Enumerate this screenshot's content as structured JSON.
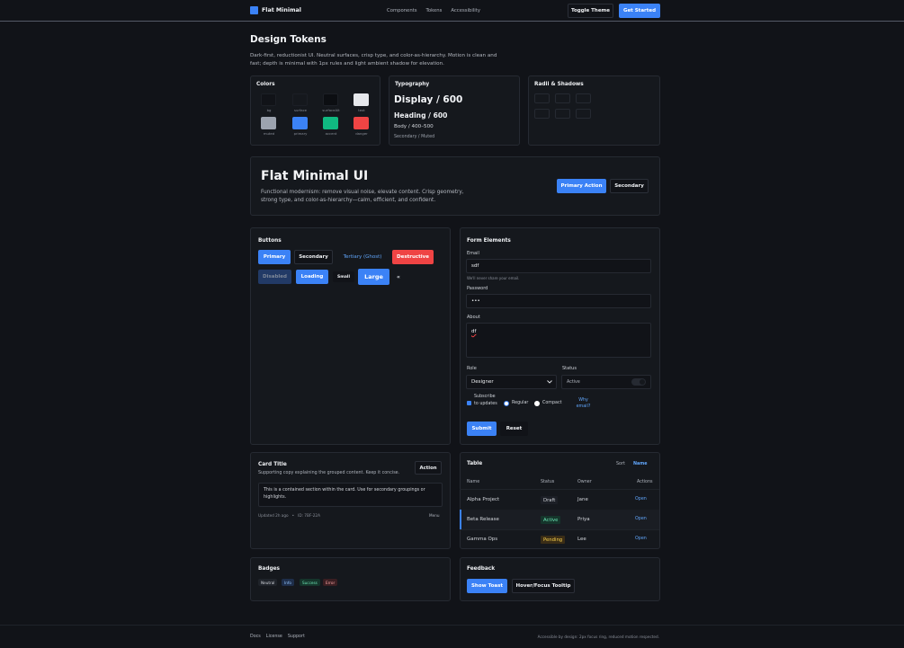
{
  "brand": {
    "name": "Flat Minimal"
  },
  "nav": [
    "Components",
    "Tokens",
    "Accessibility"
  ],
  "header": {
    "toggle_theme": "Toggle Theme",
    "get_started": "Get Started"
  },
  "intro": {
    "title": "Design Tokens",
    "description": "Dark-first, reductionist UI. Neutral surfaces, crisp type, and color-as-hierarchy. Motion is clean and fast; depth is minimal with 1px rules and light ambient shadow for elevation."
  },
  "colors": {
    "title": "Colors",
    "swatches": [
      {
        "label": "bg",
        "color": "#111318"
      },
      {
        "label": "surface",
        "color": "#15181d"
      },
      {
        "label": "surfaceAlt",
        "color": "#0c0e12"
      },
      {
        "label": "text",
        "color": "#e6e8ec"
      },
      {
        "label": "muted",
        "color": "#9ca3af"
      },
      {
        "label": "primary",
        "color": "#3b82f6"
      },
      {
        "label": "accent",
        "color": "#10b981"
      },
      {
        "label": "danger",
        "color": "#ef4444"
      }
    ]
  },
  "typography": {
    "title": "Typography",
    "display": "Display / 600",
    "heading": "Heading / 600",
    "body": "Body / 400–500",
    "muted": "Secondary / Muted"
  },
  "radii": {
    "title": "Radii & Shadows"
  },
  "hero": {
    "title": "Flat Minimal UI",
    "description": "Functional modernism: remove visual noise, elevate content. Crisp geometry, strong type, and color-as-hierarchy—calm, efficient, and confident.",
    "primary": "Primary Action",
    "secondary": "Secondary"
  },
  "buttons": {
    "title": "Buttons",
    "primary": "Primary",
    "secondary": "Secondary",
    "tertiary": "Tertiary (Ghost)",
    "destructive": "Destructive",
    "disabled": "Disabled",
    "loading": "Loading",
    "small": "Small",
    "large": "Large",
    "icon": "«"
  },
  "form": {
    "title": "Form Elements",
    "email_label": "Email",
    "email_value": "sdf",
    "email_hint": "We'll never share your email.",
    "password_label": "Password",
    "password_value": "•••",
    "about_label": "About",
    "about_value": "df",
    "role_label": "Role",
    "role_value": "Designer",
    "status_label": "Status",
    "status_value": "Active",
    "subscribe_label": "Subscribe to updates",
    "radio_regular": "Regular",
    "radio_compact": "Compact",
    "why_email": "Why email?",
    "submit": "Submit",
    "reset": "Reset"
  },
  "card": {
    "title": "Card Title",
    "subtitle": "Supporting copy explaining the grouped content. Keep it concise.",
    "action": "Action",
    "inner": "This is a contained section within the card. Use for secondary groupings or highlights.",
    "meta_updated": "Updated 2h ago",
    "meta_dot": "•",
    "meta_id": "ID: 7BF-22A",
    "menu": "Menu"
  },
  "table": {
    "title": "Table",
    "sort_label": "Sort",
    "sort_value": "Name",
    "headers": [
      "Name",
      "Status",
      "Owner",
      "Actions"
    ],
    "rows": [
      {
        "name": "Alpha Project",
        "status": "Draft",
        "owner": "Jane",
        "action": "Open"
      },
      {
        "name": "Beta Release",
        "status": "Active",
        "owner": "Priya",
        "action": "Open"
      },
      {
        "name": "Gamma Ops",
        "status": "Pending",
        "owner": "Lee",
        "action": "Open"
      }
    ]
  },
  "badges": {
    "title": "Badges",
    "items": [
      "Neutral",
      "Info",
      "Success",
      "Error"
    ]
  },
  "feedback": {
    "title": "Feedback",
    "toast": "Show Toast",
    "tooltip": "Hover/Focus Tooltip"
  },
  "footer": {
    "links": [
      "Docs",
      "License",
      "Support"
    ],
    "note": "Accessible by design: 2px focus ring, reduced motion respected."
  }
}
